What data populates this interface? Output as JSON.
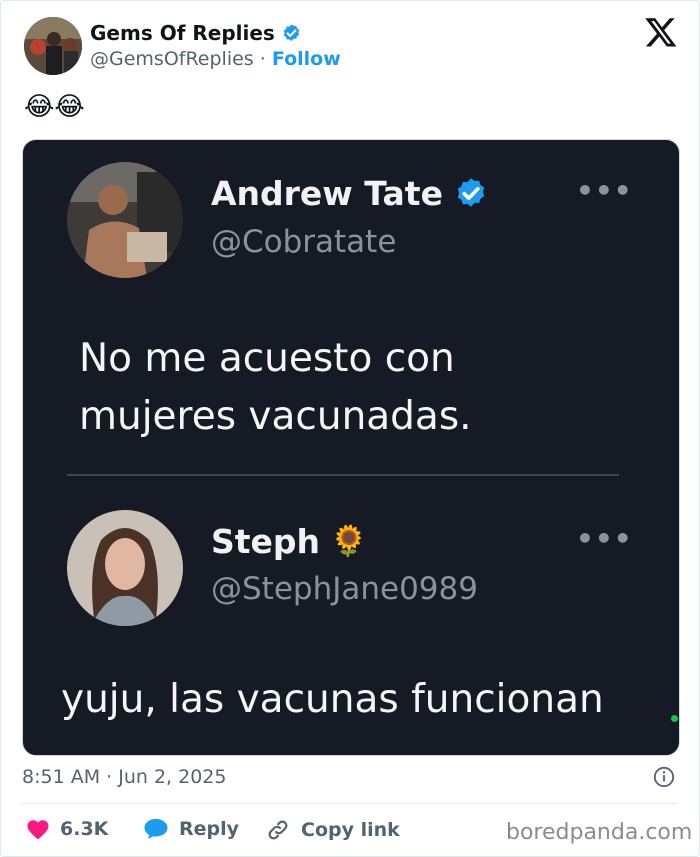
{
  "post": {
    "author_name": "Gems Of Replies",
    "author_handle": "@GemsOfReplies",
    "separator": "·",
    "follow_label": "Follow",
    "body_emoji": "😂😂"
  },
  "embedded": {
    "tweet1": {
      "name": "Andrew Tate",
      "handle": "@Cobratate",
      "line1": "No me acuesto con",
      "line2": "mujeres vacunadas."
    },
    "tweet2": {
      "name": "Steph",
      "name_emoji": "🌻",
      "handle": "@StephJane0989",
      "text": "yuju, las vacunas funcionan"
    },
    "more_label": "•••"
  },
  "footer": {
    "timestamp": "8:51 AM · Jun 2, 2025",
    "likes": "6.3K",
    "reply_label": "Reply",
    "copy_label": "Copy link",
    "watermark": "boredpanda.com"
  },
  "colors": {
    "accent": "#1d9bf0",
    "like": "#f91880",
    "card_bg": "#151a25"
  },
  "icons": [
    "verified-badge-icon",
    "x-logo-icon",
    "info-icon",
    "heart-icon",
    "reply-bubble-icon",
    "link-icon",
    "more-dots-icon"
  ]
}
